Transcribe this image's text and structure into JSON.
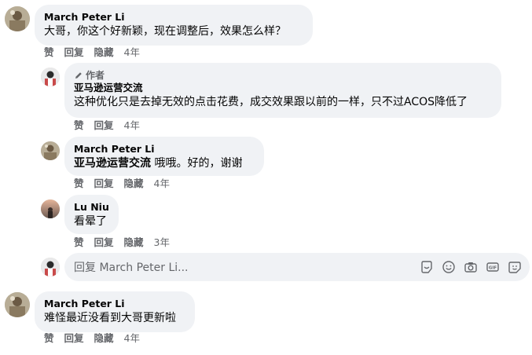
{
  "comments": [
    {
      "author": "March Peter Li",
      "text": "大哥，你这个好新颖，现在调整后，效果怎么样？",
      "actions": [
        "赞",
        "回复",
        "隐藏"
      ],
      "time": "4年"
    },
    {
      "badge": "作者",
      "author": "亚马逊运营交流",
      "text": "这种优化只是去掉无效的点击花费，成交效果跟以前的一样，只不过ACOS降低了",
      "actions": [
        "赞",
        "回复"
      ],
      "time": "4年"
    },
    {
      "author": "March Peter Li",
      "mention": "亚马逊运营交流",
      "text": " 哦哦。好的，谢谢",
      "actions": [
        "赞",
        "回复",
        "隐藏"
      ],
      "time": "4年"
    },
    {
      "author": "Lu Niu",
      "text": "看晕了",
      "actions": [
        "赞",
        "回复",
        "隐藏"
      ],
      "time": "3年"
    },
    {
      "author": "March Peter Li",
      "text": "难怪最近没看到大哥更新啦",
      "actions": [
        "赞",
        "回复",
        "隐藏"
      ],
      "time": "4年"
    }
  ],
  "reply_box": {
    "placeholder": "回复 March Peter Li...",
    "icons": [
      "sticker-icon",
      "emoji-icon",
      "camera-icon",
      "gif-icon",
      "avatar-sticker-icon"
    ]
  }
}
